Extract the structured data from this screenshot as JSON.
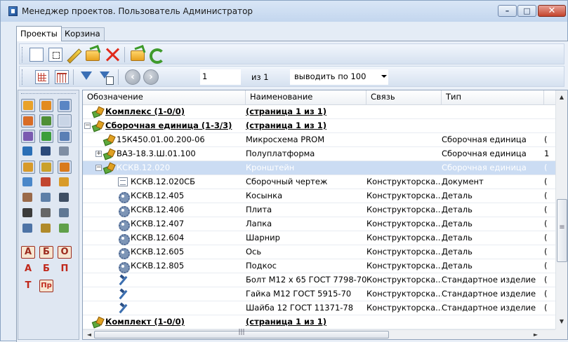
{
  "window": {
    "title": "Менеджер проектов. Пользователь Администратор"
  },
  "tabs": [
    "Проекты",
    "Корзина"
  ],
  "toolbar1": {
    "icons": [
      "new-document-icon",
      "new-from-template-icon",
      "edit-icon",
      "open-folder-icon",
      "delete-icon",
      "import-folder-icon",
      "refresh-icon"
    ]
  },
  "toolbar2": {
    "icons": [
      "calculator-icon",
      "table-icon",
      "filter-icon",
      "filter-settings-icon"
    ],
    "nav_prev": "‹",
    "nav_next": "›",
    "page_value": "1",
    "of_pages": "из 1",
    "per_page": "выводить по 100"
  },
  "sidebar": {
    "icons": [
      "folder-icon",
      "folder-open-icon",
      "window-icon",
      "parts-icon",
      "assembly-icon",
      "list-icon",
      "assembly-alt-icon",
      "assembly-green-icon",
      "gear-icon",
      "wrench-icon",
      "question-icon",
      "eraser-icon",
      "link-assembly-icon",
      "gear-orange-icon",
      "settings-icon",
      "chart-icon",
      "chart-red-icon",
      "document-star-icon",
      "tools-icon",
      "search-doc-icon",
      "cursor-icon",
      "magic-icon",
      "barcode-icon",
      "drawer-icon",
      "gear-blue-icon",
      "assembly-gear-icon",
      "tools-green-icon"
    ],
    "letters_boxed": [
      "A",
      "Б",
      "О"
    ],
    "letters_plain": [
      "А",
      "Б",
      "П"
    ],
    "letter_t": "Т",
    "letter_pr": "Пр"
  },
  "grid": {
    "columns": [
      "Обозначение",
      "Наименование",
      "Связь",
      "Тип"
    ],
    "rows": [
      {
        "designation": "Комплекс (1-0/0)",
        "name": "(страница 1 из 1)",
        "link": "",
        "type": "",
        "extra": ""
      },
      {
        "designation": "Сборочная единица (1-3/3)",
        "name": "(страница 1 из 1)",
        "link": "",
        "type": "",
        "extra": ""
      },
      {
        "designation": "15К450.01.00.200-06",
        "name": "Микросхема PROM",
        "link": "",
        "type": "Сборочная единица",
        "extra": "("
      },
      {
        "designation": "ВАЗ-18.3.Ш.01.100",
        "name": "Полуплатформа",
        "link": "",
        "type": "Сборочная единица",
        "extra": "1"
      },
      {
        "designation": "КСКВ.12.020",
        "name": "Кронштейн",
        "link": "",
        "type": "Сборочная единица",
        "extra": "("
      },
      {
        "designation": "КСКВ.12.020СБ",
        "name": "Сборочный чертеж",
        "link": "Конструкторска...",
        "type": "Документ",
        "extra": "("
      },
      {
        "designation": "КСКВ.12.405",
        "name": "Косынка",
        "link": "Конструкторска...",
        "type": "Деталь",
        "extra": "("
      },
      {
        "designation": "КСКВ.12.406",
        "name": "Плита",
        "link": "Конструкторска...",
        "type": "Деталь",
        "extra": "("
      },
      {
        "designation": "КСКВ.12.407",
        "name": "Лапка",
        "link": "Конструкторска...",
        "type": "Деталь",
        "extra": "("
      },
      {
        "designation": "КСКВ.12.604",
        "name": "Шарнир",
        "link": "Конструкторска...",
        "type": "Деталь",
        "extra": "("
      },
      {
        "designation": "КСКВ.12.605",
        "name": "Ось",
        "link": "Конструкторска...",
        "type": "Деталь",
        "extra": "("
      },
      {
        "designation": "КСКВ.12.805",
        "name": "Подкос",
        "link": "Конструкторска...",
        "type": "Деталь",
        "extra": "("
      },
      {
        "designation": "",
        "name": "Болт М12 х 65 ГОСТ 7798-70",
        "link": "Конструкторска...",
        "type": "Стандартное изделие",
        "extra": "("
      },
      {
        "designation": "",
        "name": "Гайка М12 ГОСТ 5915-70",
        "link": "Конструкторска...",
        "type": "Стандартное изделие",
        "extra": "("
      },
      {
        "designation": "",
        "name": "Шайба 12 ГОСТ 11371-78",
        "link": "Конструкторска...",
        "type": "Стандартное изделие",
        "extra": "("
      },
      {
        "designation": "Комплект (1-0/0)",
        "name": "(страница 1 из 1)",
        "link": "",
        "type": "",
        "extra": ""
      }
    ]
  }
}
